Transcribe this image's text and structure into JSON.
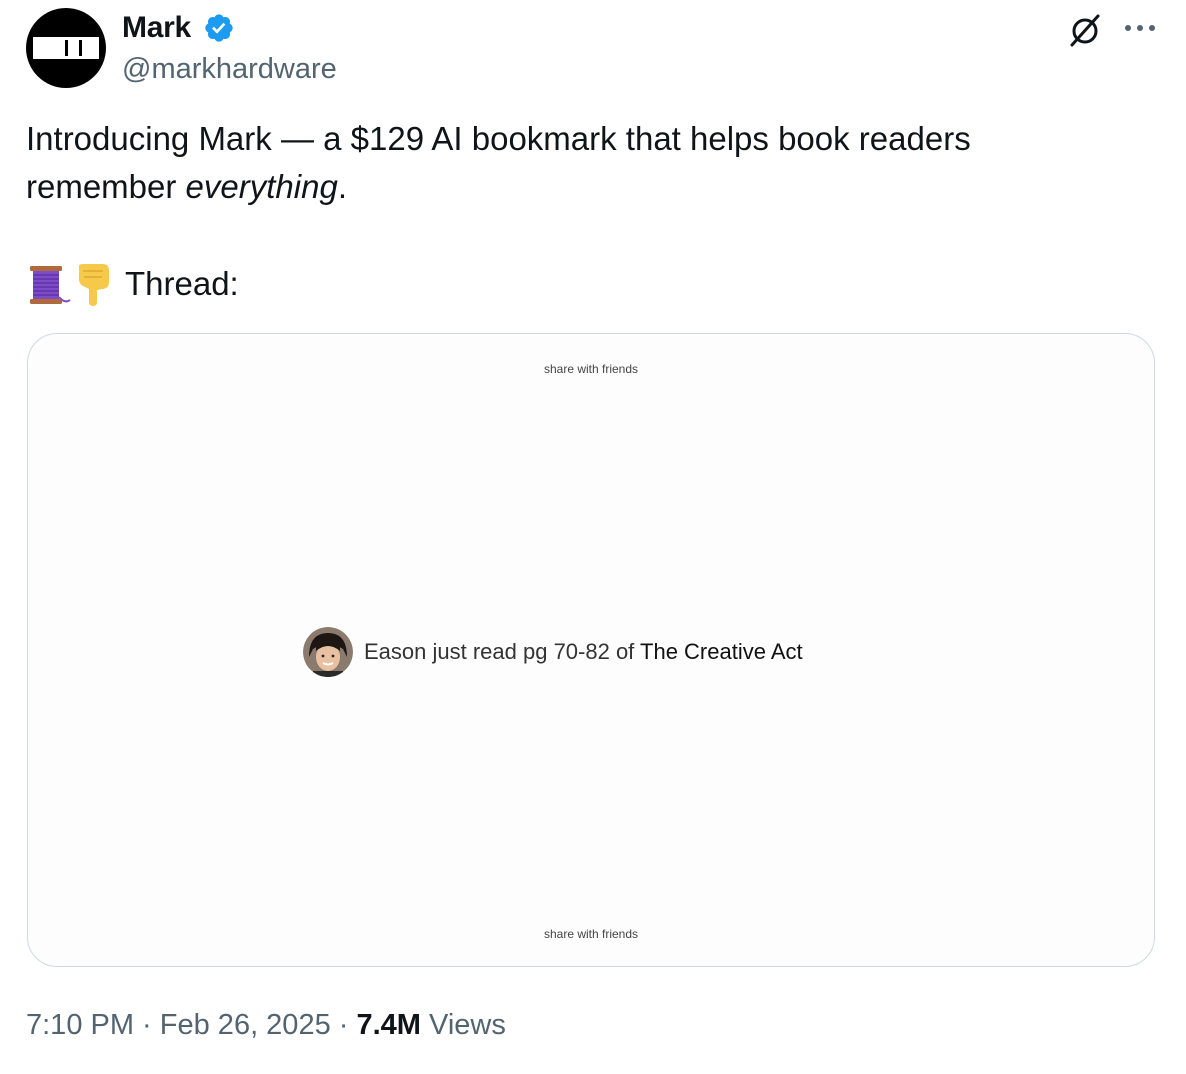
{
  "author": {
    "display_name": "Mark",
    "handle": "@markhardware",
    "verified": true,
    "avatar_icon": "mark-logo-icon"
  },
  "actions": {
    "grok_icon": "grok-icon",
    "more_icon": "more-icon"
  },
  "tweet": {
    "line1": "Introducing Mark — a $129 AI bookmark that helps book readers",
    "line2_prefix": "remember ",
    "line2_emphasis": "everything",
    "line2_suffix": ".",
    "thread_label": "Thread:",
    "emojis": [
      "spool-of-thread-emoji",
      "pointing-down-emoji"
    ]
  },
  "media": {
    "share_top": "share with friends",
    "share_bottom": "share with friends",
    "reader_text": "Eason just read pg 70-82 of ",
    "book_title": "The Creative Act"
  },
  "meta": {
    "time": "7:10 PM",
    "separator1": " · ",
    "date": "Feb 26, 2025",
    "separator2": " · ",
    "views_count": "7.4M",
    "views_label": " Views"
  },
  "colors": {
    "text_primary": "#0f1419",
    "text_secondary": "#536471",
    "verified_blue": "#1d9bf0",
    "card_border": "#cfd9de"
  }
}
